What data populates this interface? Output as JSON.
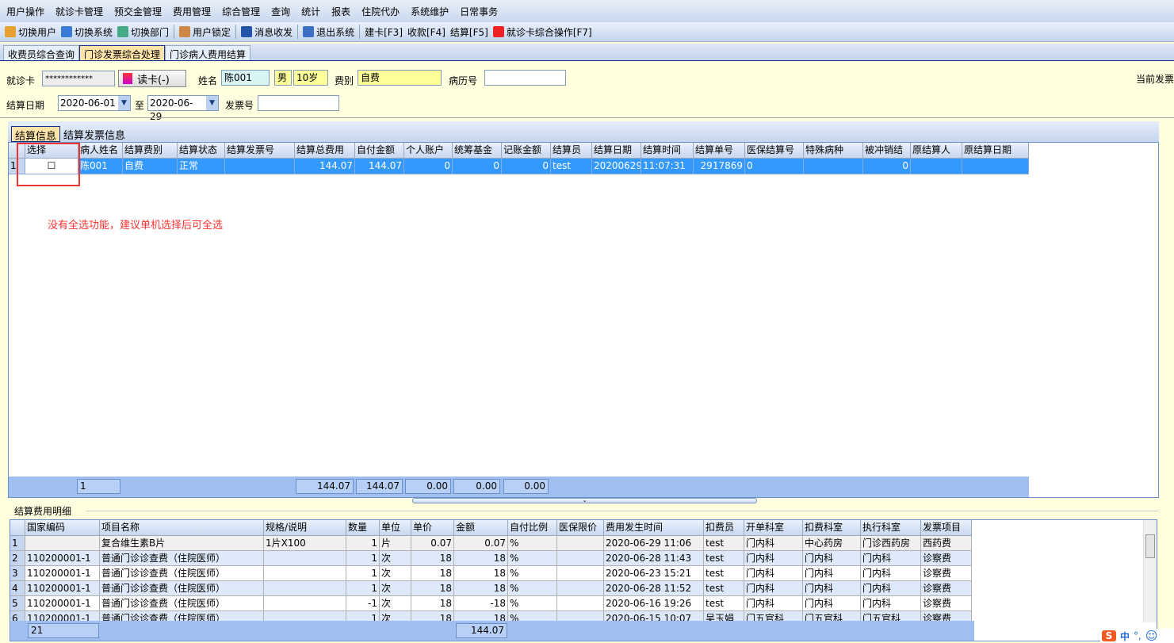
{
  "menu": [
    "用户操作",
    "就诊卡管理",
    "预交金管理",
    "费用管理",
    "综合管理",
    "查询",
    "统计",
    "报表",
    "住院代办",
    "系统维护",
    "日常事务"
  ],
  "toolbar": [
    {
      "label": "切换用户",
      "icon": "users-icon"
    },
    {
      "label": "切换系统",
      "icon": "switch-system-icon"
    },
    {
      "label": "切换部门",
      "icon": "department-icon"
    },
    {
      "label": "用户锁定",
      "icon": "lock-user-icon"
    },
    {
      "label": "消息收发",
      "icon": "info-icon"
    },
    {
      "label": "退出系统",
      "icon": "exit-icon"
    },
    {
      "label": "建卡[F3]",
      "icon": ""
    },
    {
      "label": "收款[F4]",
      "icon": ""
    },
    {
      "label": "结算[F5]",
      "icon": ""
    },
    {
      "label": "就诊卡综合操作[F7]",
      "icon": "card-operation-icon"
    }
  ],
  "tabs": [
    "收费员综合查询",
    "门诊发票综合处理",
    "门诊病人费用结算"
  ],
  "form": {
    "card_label": "就诊卡",
    "card_value": "************",
    "read_card": "读卡(-)",
    "name_label": "姓名",
    "name_value": "陈001",
    "sex": "男",
    "age": "10岁",
    "fee_type_label": "费别",
    "fee_type": "自费",
    "record_label": "病历号",
    "record_value": "",
    "current_invoice_label": "当前发票",
    "date_label": "结算日期",
    "date_from": "2020-06-01",
    "to_label": "至",
    "date_to": "2020-06-29",
    "invoice_label": "发票号",
    "invoice_value": ""
  },
  "upper": {
    "tabs": [
      "结算信息",
      "结算发票信息"
    ],
    "columns": [
      "",
      "选择",
      "病人姓名",
      "结算费别",
      "结算状态",
      "结算发票号",
      "结算总费用",
      "自付金额",
      "个人账户",
      "统筹基金",
      "记账金额",
      "结算员",
      "结算日期",
      "结算时间",
      "结算单号",
      "医保结算号",
      "特殊病种",
      "被冲销结",
      "原结算人",
      "原结算日期"
    ],
    "rows": [
      [
        "1",
        "☐",
        "陈001",
        "自费",
        "正常",
        "",
        "144.07",
        "144.07",
        "0",
        "0",
        "0",
        "test",
        "20200629",
        "11:07:31",
        "2917869",
        "0",
        "",
        "0",
        "",
        ""
      ]
    ],
    "footer": {
      "count": "1",
      "total": "144.07",
      "self_pay": "144.07",
      "personal": "0.00",
      "pool": "0.00",
      "account": "0.00"
    }
  },
  "annotation": "没有全选功能，建议单机选择后可全选",
  "lower": {
    "title": "结算费用明细",
    "columns": [
      "",
      "国家编码",
      "项目名称",
      "规格/说明",
      "数量",
      "单位",
      "单价",
      "金额",
      "自付比例",
      "医保限价",
      "费用发生时间",
      "扣费员",
      "开单科室",
      "扣费科室",
      "执行科室",
      "发票项目"
    ],
    "rows": [
      [
        "1",
        "",
        "复合维生素B片",
        "1片X100",
        "1",
        "片",
        "0.07",
        "0.07",
        "%",
        "",
        "2020-06-29 11:06",
        "test",
        "门内科",
        "中心药房",
        "门诊西药房",
        "西药费"
      ],
      [
        "2",
        "110200001-1",
        "普通门诊诊查费（住院医师）",
        "",
        "1",
        "次",
        "18",
        "18",
        "%",
        "",
        "2020-06-28 11:43",
        "test",
        "门内科",
        "门内科",
        "门内科",
        "诊察费"
      ],
      [
        "3",
        "110200001-1",
        "普通门诊诊查费（住院医师）",
        "",
        "1",
        "次",
        "18",
        "18",
        "%",
        "",
        "2020-06-23 15:21",
        "test",
        "门内科",
        "门内科",
        "门内科",
        "诊察费"
      ],
      [
        "4",
        "110200001-1",
        "普通门诊诊查费（住院医师）",
        "",
        "1",
        "次",
        "18",
        "18",
        "%",
        "",
        "2020-06-28 11:52",
        "test",
        "门内科",
        "门内科",
        "门内科",
        "诊察费"
      ],
      [
        "5",
        "110200001-1",
        "普通门诊诊查费（住院医师）",
        "",
        "-1",
        "次",
        "18",
        "-18",
        "%",
        "",
        "2020-06-16 19:26",
        "test",
        "门内科",
        "门内科",
        "门内科",
        "诊察费"
      ],
      [
        "6",
        "110200001-1",
        "普通门诊诊查费（住院医师）",
        "",
        "1",
        "次",
        "18",
        "18",
        "%",
        "",
        "2020-06-15 10:07",
        "吴玉娟",
        "门五官科",
        "门五官科",
        "门五官科",
        "诊察费"
      ]
    ],
    "footer": {
      "count": "21",
      "total": "144.07"
    }
  },
  "ime": {
    "logo": "S",
    "lang": "中",
    "punct": "°,",
    "emoji": "☺"
  },
  "colors": {
    "selected_row": "#3399ff",
    "annotation": "#ff3333",
    "panel": "#ffffe0"
  }
}
